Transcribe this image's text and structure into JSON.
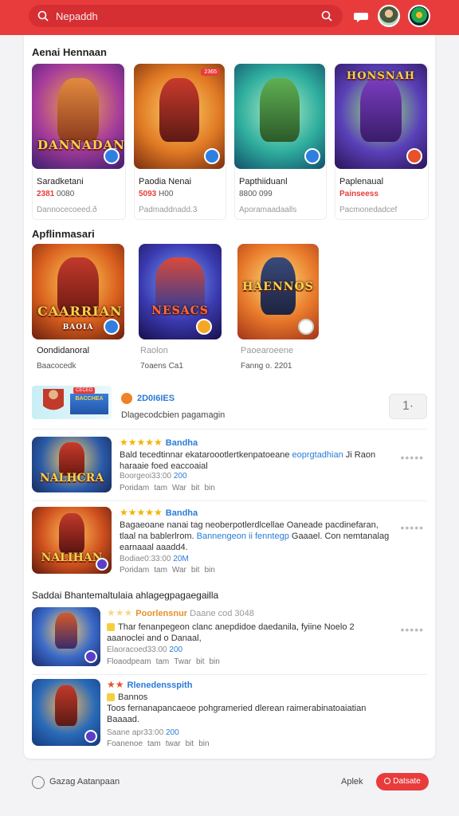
{
  "topbar": {
    "search_placeholder": "Nepaddh",
    "search_icon": "search-icon",
    "chat_icon": "chat-bubble-icon",
    "colors": {
      "bar": "#e83c3c",
      "search": "#d52f34"
    }
  },
  "section1": {
    "title": "Aenai Hennaan",
    "items": [
      {
        "title": "Saradketani",
        "price": "2381",
        "meta": "0080",
        "sub": "Dannocecoeed.ð",
        "wordmark": "DANNADAN",
        "tag": ""
      },
      {
        "title": "Paodia Nenai",
        "price": "5093",
        "meta": "H00",
        "sub": "Padmaddnadd.3",
        "wordmark": "",
        "tag": "2365"
      },
      {
        "title": "Papthiiduanl",
        "price": "",
        "meta": "8800 099",
        "sub": "Aporamaadaalls",
        "wordmark": "",
        "tag": ""
      },
      {
        "title": "Paplenaual",
        "price": "Painseess",
        "meta": "",
        "sub": "Pacmonedadcef",
        "wordmark": "HONSNAH",
        "tag": ""
      }
    ]
  },
  "section2": {
    "title": "Apflinmasari",
    "items": [
      {
        "title": "Oondidanoral",
        "meta": "Baacocedk",
        "wordmark": "CAARRIAN",
        "sub_mark": "BAOIA"
      },
      {
        "title": "Raolon",
        "meta": "7oaens  Ca1",
        "wordmark": "NESACS",
        "sub_mark": ""
      },
      {
        "title": "Paoearoeene",
        "meta": "Fanng o. 2201",
        "wordmark": "HAENNOS",
        "sub_mark": ""
      }
    ]
  },
  "promo": {
    "label": "2D0I6IES",
    "subtitle": "Dlagecodcbien pagamagin",
    "button": "1·",
    "tag": "CECEO",
    "mini": "BACCHEA"
  },
  "reviews": [
    {
      "stars": "★★★★★",
      "user": "Bandha",
      "text_a": "Bald tecedtinnar ekataroootlertkenpatoeane ",
      "text_blue": "eoprgtadhian",
      "text_b": " Ji Raon haraaie foed eaccoaial",
      "meta": "Boorgeoi33:00",
      "meta_blue": "200",
      "acts": [
        "Poridam",
        "tam",
        "War",
        "bit",
        "bin"
      ],
      "wordmark": "NALHCRA"
    },
    {
      "stars": "★★★★★",
      "user": "Bandha",
      "text_a": "Bagaeoane nanai tag neoberpotlerdlcellae Oaneade pacdinefaran, tlaal na bablerlrom. ",
      "text_blue": "Bannengeon ii fenntegp",
      "text_b": " Gaaael.  Con nemtanalag earnaaal aaadd4.",
      "meta": "Bodiae0:33:00",
      "meta_blue": "20M",
      "acts": [
        "Poridam",
        "tam",
        "War",
        "bit",
        "bin"
      ],
      "wordmark": "NALIHAN"
    }
  ],
  "section3": {
    "title": "Saddai Bhantemaltulaia ahlagegpagaegailla"
  },
  "reviews2": [
    {
      "stars": "★★★",
      "user": "Poorlensnur",
      "meta_head": "Daane cod 3048",
      "text_a": "Thar fenanpegeon clanc anepdidoe daedanila, ",
      "text_b": "fyiine Noelo 2 aaanoclei and o Danaal,",
      "meta": "Elaoracoed33:00",
      "meta_blue": "200",
      "acts": [
        "Floaodpeam",
        "tam",
        "Twar",
        "bit",
        "bin"
      ]
    },
    {
      "stars": "★★",
      "user": "Rlenedensspith",
      "line2": "Bannos",
      "text_a": "Toos fernanapancaeoe pohgrameried dlerean raimerabinatoaiatian Baaaad.",
      "text_b": "",
      "meta": "Saane apr33:00",
      "meta_blue": "200",
      "acts": [
        "Foanenoe",
        "tam",
        "twar",
        "bit",
        "bin"
      ]
    }
  ],
  "footer": {
    "label": "Gazag Aatanpaan",
    "apk": "Aplek",
    "button": "Datsate"
  }
}
